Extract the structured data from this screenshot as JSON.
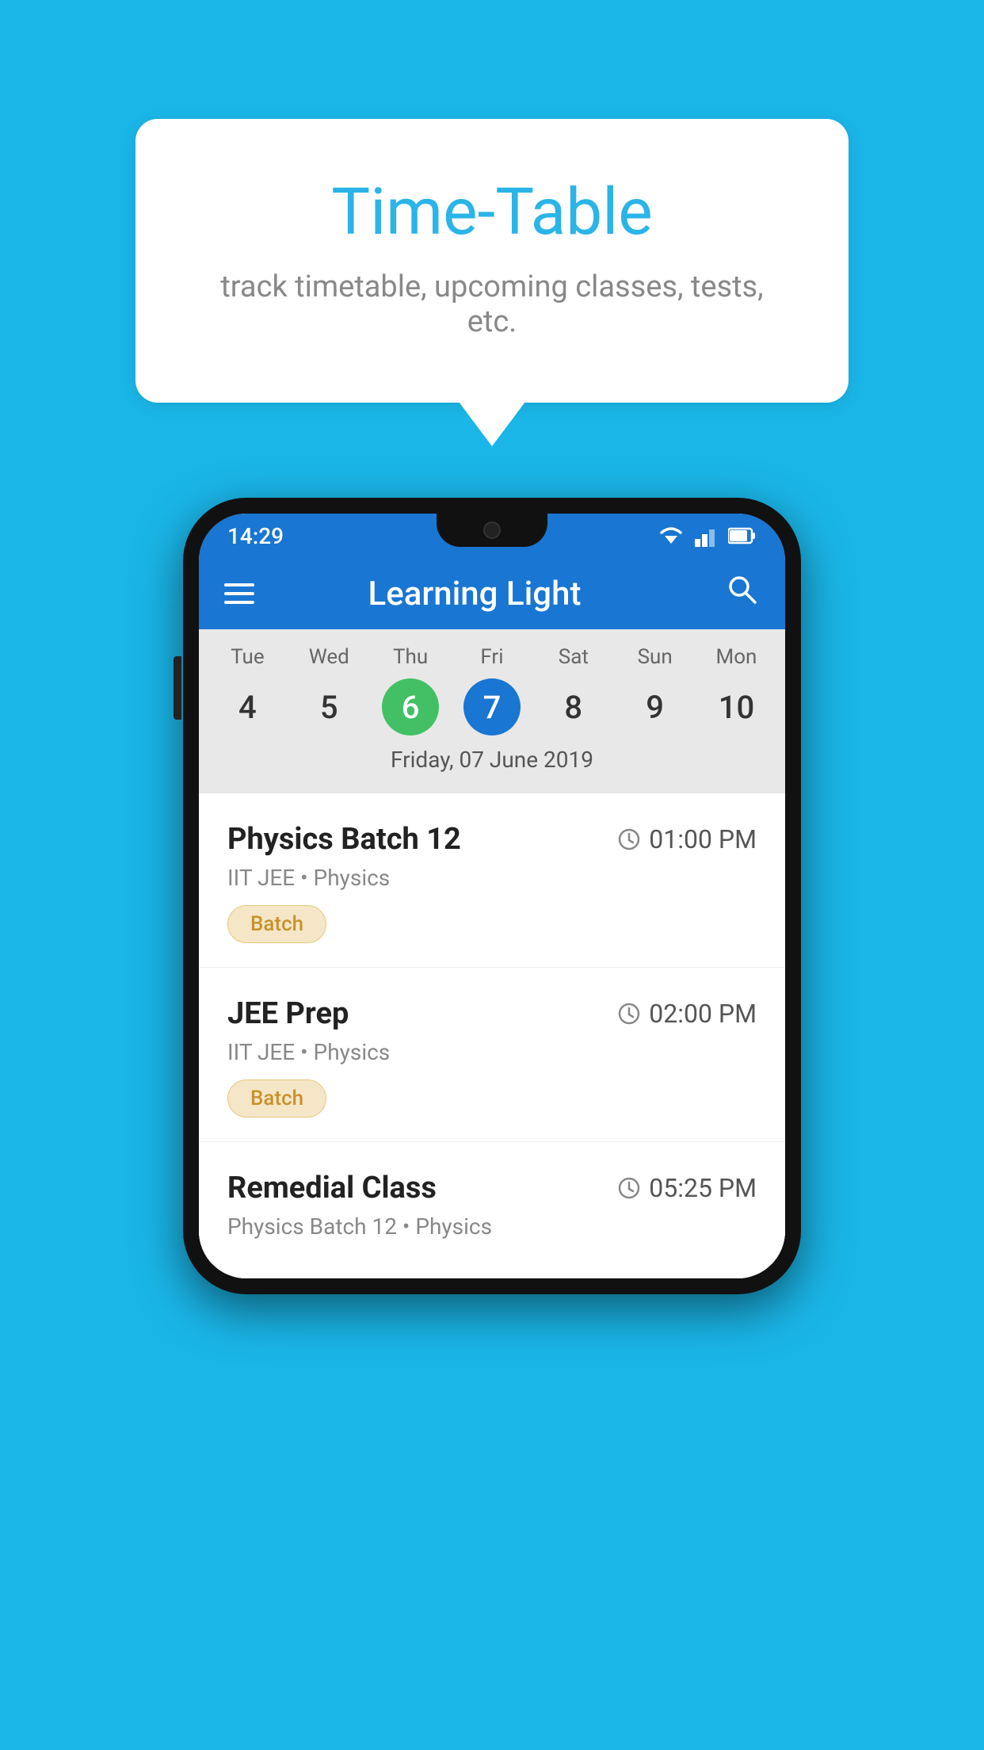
{
  "background_color": "#1ab6e8",
  "bubble": {
    "title": "Time-Table",
    "subtitle": "track timetable, upcoming classes, tests, etc."
  },
  "phone": {
    "status_bar": {
      "time": "14:29"
    },
    "app_bar": {
      "title": "Learning Light"
    },
    "calendar": {
      "days": [
        {
          "name": "Tue",
          "num": "4",
          "state": "normal"
        },
        {
          "name": "Wed",
          "num": "5",
          "state": "normal"
        },
        {
          "name": "Thu",
          "num": "6",
          "state": "today"
        },
        {
          "name": "Fri",
          "num": "7",
          "state": "selected"
        },
        {
          "name": "Sat",
          "num": "8",
          "state": "normal"
        },
        {
          "name": "Sun",
          "num": "9",
          "state": "normal"
        },
        {
          "name": "Mon",
          "num": "10",
          "state": "normal"
        }
      ],
      "selected_date_label": "Friday, 07 June 2019"
    },
    "schedule": [
      {
        "name": "Physics Batch 12",
        "time": "01:00 PM",
        "meta": "IIT JEE • Physics",
        "badge": "Batch"
      },
      {
        "name": "JEE Prep",
        "time": "02:00 PM",
        "meta": "IIT JEE • Physics",
        "badge": "Batch"
      },
      {
        "name": "Remedial Class",
        "time": "05:25 PM",
        "meta": "Physics Batch 12 • Physics",
        "badge": null
      }
    ]
  }
}
